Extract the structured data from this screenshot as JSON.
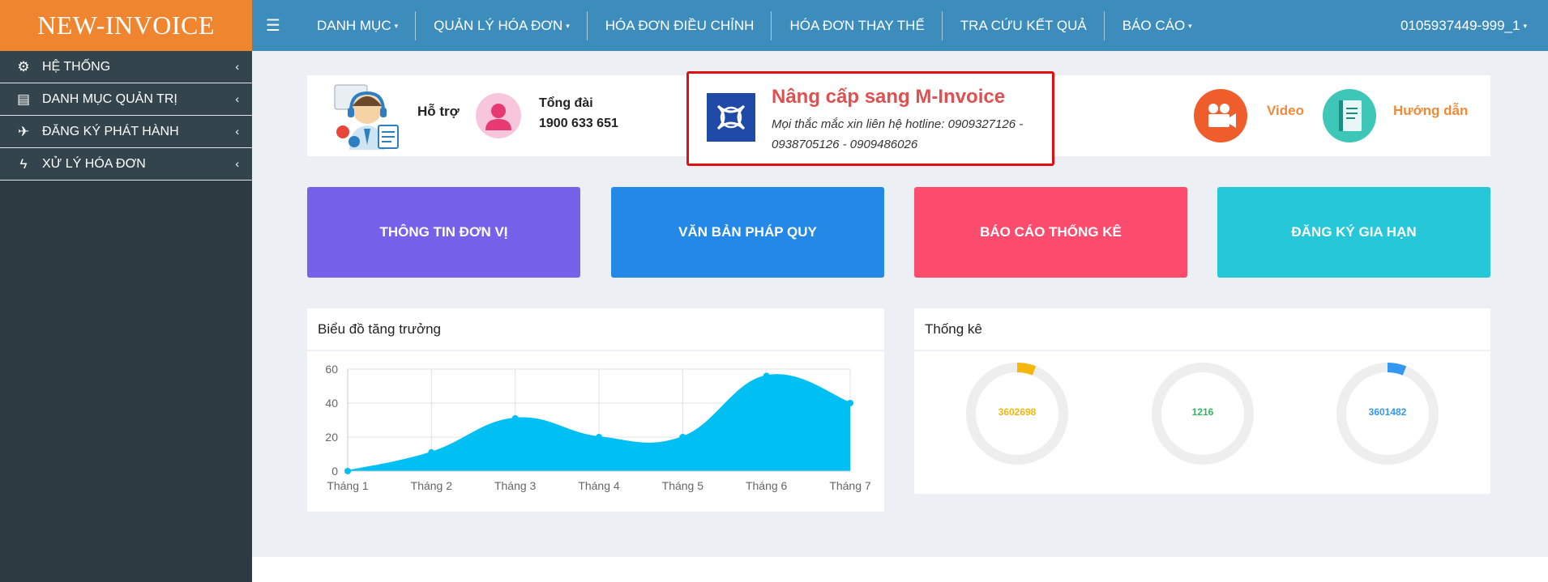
{
  "brand": {
    "logo": "NEW-INVOICE"
  },
  "topnav": {
    "menu_icon": "hamburger-icon",
    "items": [
      {
        "label": "DANH MỤC",
        "caret": "▾"
      },
      {
        "label": "QUẢN LÝ HÓA ĐƠN",
        "caret": "▾"
      },
      {
        "label": "HÓA ĐƠN ĐIỀU CHỈNH"
      },
      {
        "label": "HÓA ĐƠN THAY THẾ"
      },
      {
        "label": "TRA CỨU KẾT QUẢ"
      },
      {
        "label": "BÁO CÁO",
        "caret": "▾"
      }
    ],
    "user": "0105937449-999_1",
    "user_caret": "▾"
  },
  "sidebar": {
    "items": [
      {
        "label": "HỆ THỐNG",
        "icon": "gears-icon",
        "glyph": "⚙"
      },
      {
        "label": "DANH MỤC QUẢN TRỊ",
        "icon": "document-icon",
        "glyph": "▤"
      },
      {
        "label": "ĐĂNG KÝ PHÁT HÀNH",
        "icon": "plane-icon",
        "glyph": "✈"
      },
      {
        "label": "XỬ LÝ HÓA ĐƠN",
        "icon": "bolt-icon",
        "glyph": "ϟ"
      }
    ],
    "chevron": "‹"
  },
  "support": {
    "hotro": "Hỗ trợ",
    "tongdai_label": "Tổng đài",
    "tongdai_phone": "1900 633 651"
  },
  "upgrade": {
    "title": "Nâng cấp sang M-Invoice",
    "text": "Mọi thắc mắc xin liên hệ hotline: 0909327126 - 0938705126 - 0909486026"
  },
  "links": {
    "video": "Video",
    "guide": "Hướng dẫn"
  },
  "tiles": [
    {
      "label": "THÔNG TIN ĐƠN VỊ",
      "color": "#7561ea"
    },
    {
      "label": "VĂN BẢN PHÁP QUY",
      "color": "#2488e6"
    },
    {
      "label": "BÁO CÁO THỐNG KÊ",
      "color": "#fb4c6d"
    },
    {
      "label": "ĐĂNG KÝ GIA HẠN",
      "color": "#26c7d9"
    }
  ],
  "growth_panel": {
    "title": "Biểu đồ tăng trưởng"
  },
  "stats_panel": {
    "title": "Thống kê"
  },
  "chart_data": {
    "type": "area",
    "categories": [
      "Tháng 1",
      "Tháng 2",
      "Tháng 3",
      "Tháng 4",
      "Tháng 5",
      "Tháng 6",
      "Tháng 7"
    ],
    "values": [
      0,
      11,
      31,
      20,
      20,
      56,
      40
    ],
    "ylim": [
      0,
      60
    ],
    "yticks": [
      "0",
      "20",
      "40",
      "60"
    ],
    "grid": true,
    "color": "#00bff3"
  },
  "stats": [
    {
      "value": "3602698",
      "color": "#f5b60d",
      "fraction": 0.06
    },
    {
      "value": "1216",
      "color": "#36b462",
      "fraction": 0.0
    },
    {
      "value": "3601482",
      "color": "#3497f0",
      "fraction": 0.06
    }
  ]
}
